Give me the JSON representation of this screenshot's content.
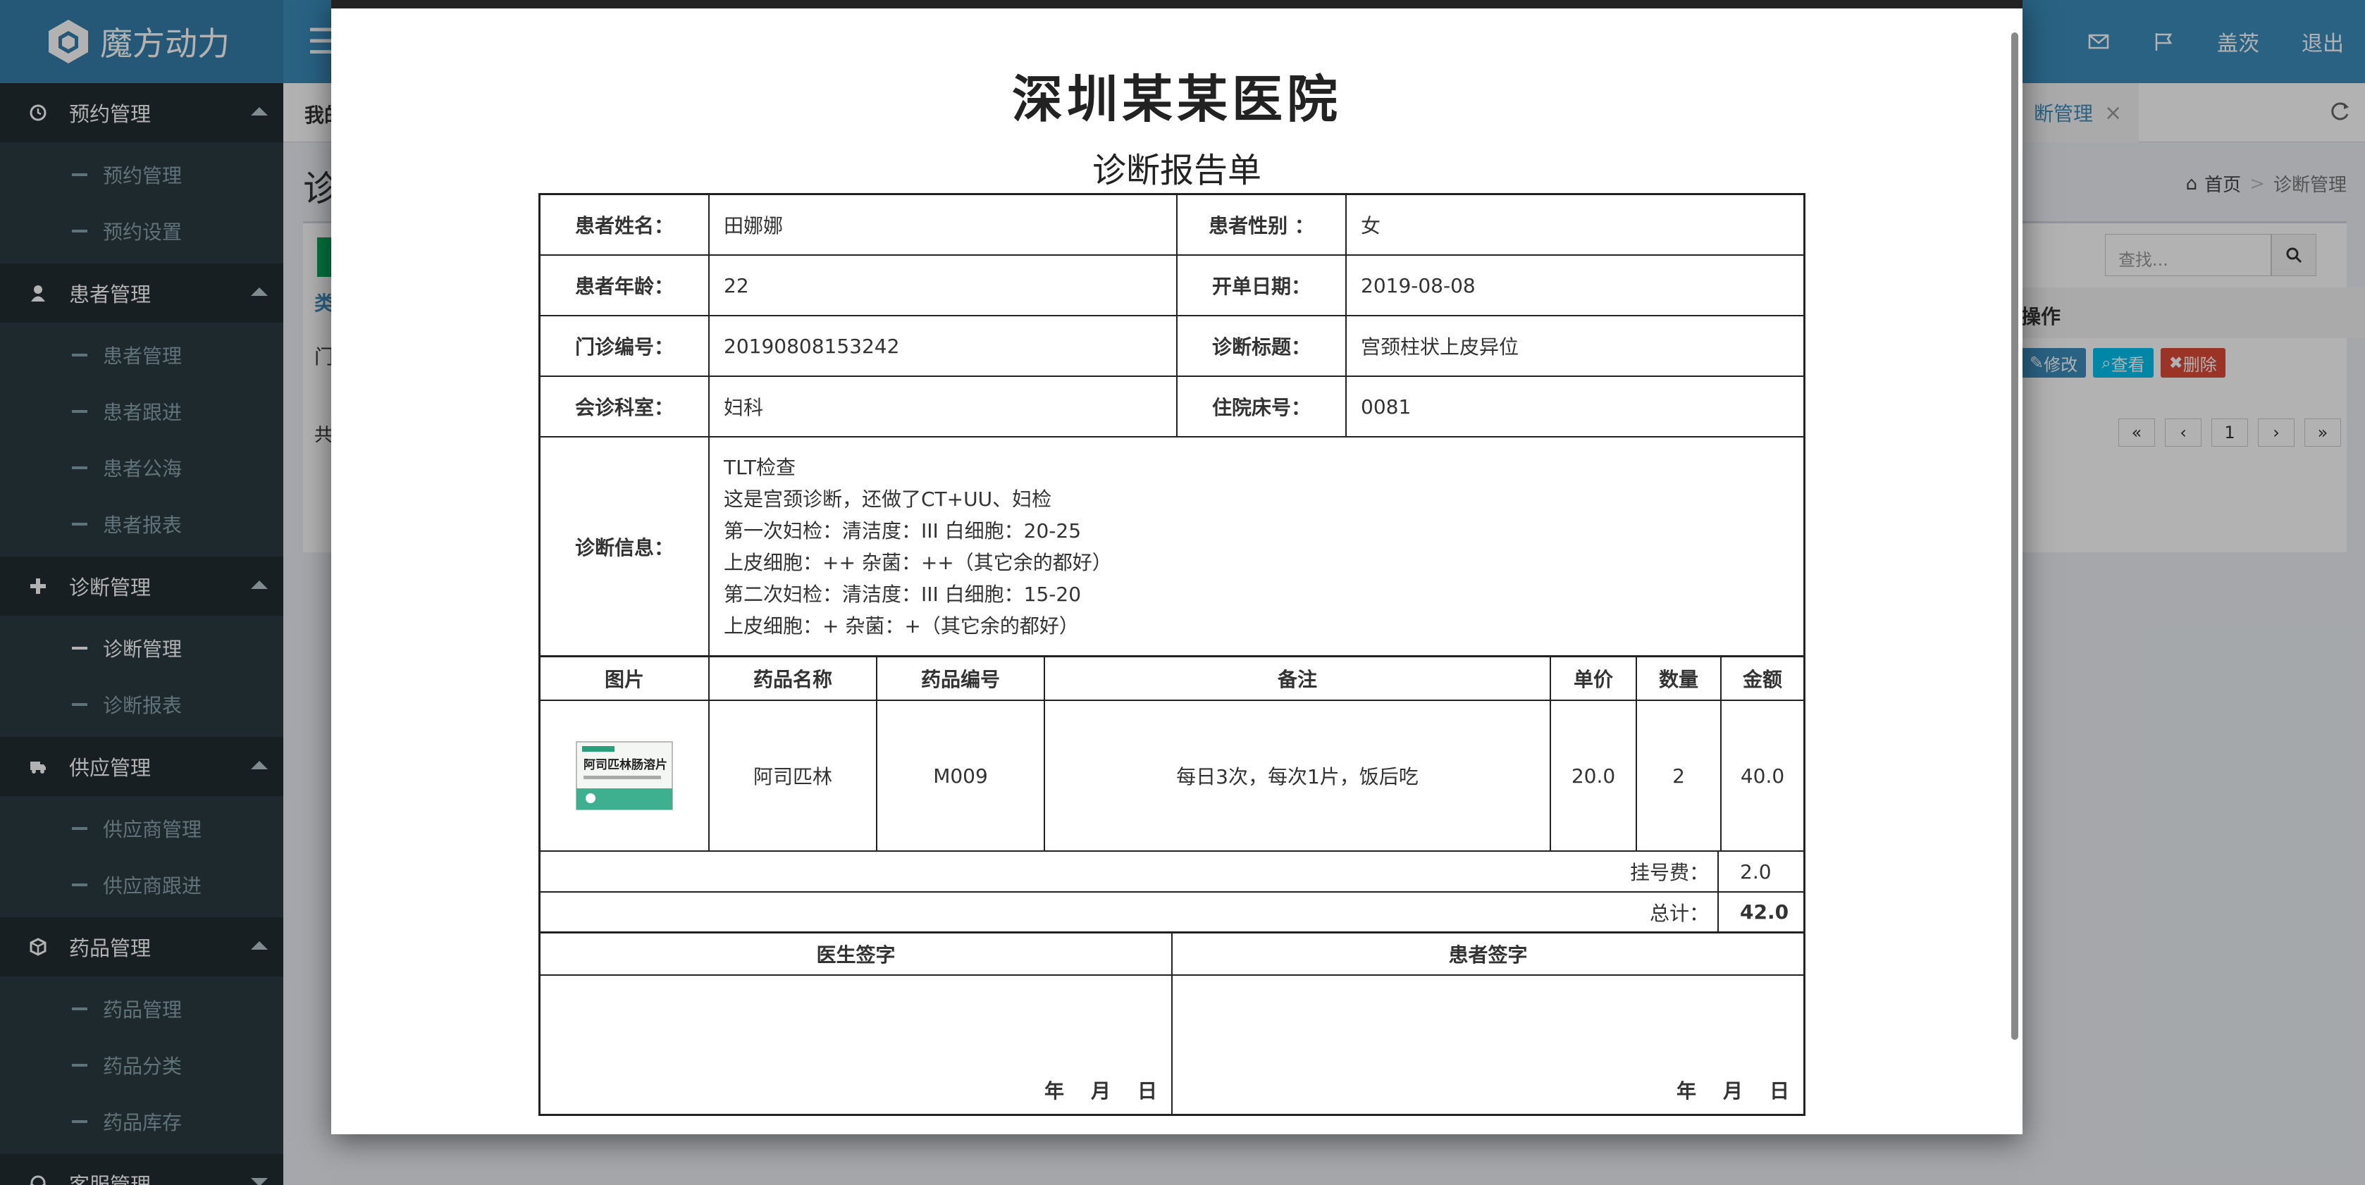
{
  "header": {
    "brand": "魔方动力",
    "menu_icon": "hamburger-icon",
    "mail_icon": "envelope-icon",
    "flag_icon": "flag-icon",
    "user": "盖茨",
    "logout": "退出"
  },
  "sidebar": {
    "groups": [
      {
        "label": "预约管理",
        "icon": "clock-icon",
        "items": [
          "预约管理",
          "预约设置"
        ]
      },
      {
        "label": "患者管理",
        "icon": "user-icon",
        "items": [
          "患者管理",
          "患者跟进",
          "患者公海",
          "患者报表"
        ]
      },
      {
        "label": "诊断管理",
        "icon": "plus-icon",
        "items": [
          "诊断管理",
          "诊断报表"
        ]
      },
      {
        "label": "供应管理",
        "icon": "truck-icon",
        "items": [
          "供应商管理",
          "供应商跟进"
        ]
      },
      {
        "label": "药品管理",
        "icon": "cube-icon",
        "items": [
          "药品管理",
          "药品分类",
          "药品库存"
        ]
      },
      {
        "label": "客服管理",
        "icon": "headset-icon",
        "items": []
      }
    ],
    "active_item": "诊断管理"
  },
  "background": {
    "tab_home": "我的",
    "tab_active": "断管理",
    "page_title": "诊",
    "panel_label1": "类",
    "panel_label2": "门",
    "panel_label3": "共",
    "breadcrumb_home": "首页",
    "breadcrumb_current": "诊断管理",
    "search_placeholder": "查找...",
    "ops_header": "操作",
    "btn_edit": "修改",
    "btn_view": "查看",
    "btn_delete": "删除",
    "page_number": "1"
  },
  "report": {
    "hospital": "深圳某某医院",
    "title": "诊断报告单",
    "fields": {
      "name_label": "患者姓名：",
      "name": "田娜娜",
      "gender_label": "患者性别 ：",
      "gender": "女",
      "age_label": "患者年龄：",
      "age": "22",
      "date_label": "开单日期：",
      "date": "2019-08-08",
      "clinic_label": "门诊编号：",
      "clinic_no": "20190808153242",
      "diag_title_label": "诊断标题：",
      "diag_title": "宫颈柱状上皮异位",
      "dept_label": "会诊科室：",
      "dept": "妇科",
      "bed_label": "住院床号：",
      "bed": "0081",
      "info_label": "诊断信息："
    },
    "diagnosis_lines": [
      "TLT检查",
      "这是宫颈诊断，还做了CT+UU、妇检",
      "第一次妇检：清洁度：III 白细胞：20-25",
      "上皮细胞：++ 杂菌：++（其它余的都好）",
      "第二次妇检：清洁度：III 白细胞：15-20",
      "上皮细胞：+ 杂菌：+（其它余的都好）"
    ],
    "drug_headers": [
      "图片",
      "药品名称",
      "药品编号",
      "备注",
      "单价",
      "数量",
      "金额"
    ],
    "drugs": [
      {
        "image_text": "阿司匹林肠溶片",
        "name": "阿司匹林",
        "code": "M009",
        "note": "每日3次，每次1片，饭后吃",
        "price": "20.0",
        "qty": "2",
        "amount": "40.0"
      }
    ],
    "fee_label": "挂号费：",
    "fee": "2.0",
    "total_label": "总计：",
    "total": "42.0",
    "doctor_sign": "医生签字",
    "patient_sign": "患者签字",
    "date_parts": [
      "年",
      "月",
      "日"
    ]
  }
}
